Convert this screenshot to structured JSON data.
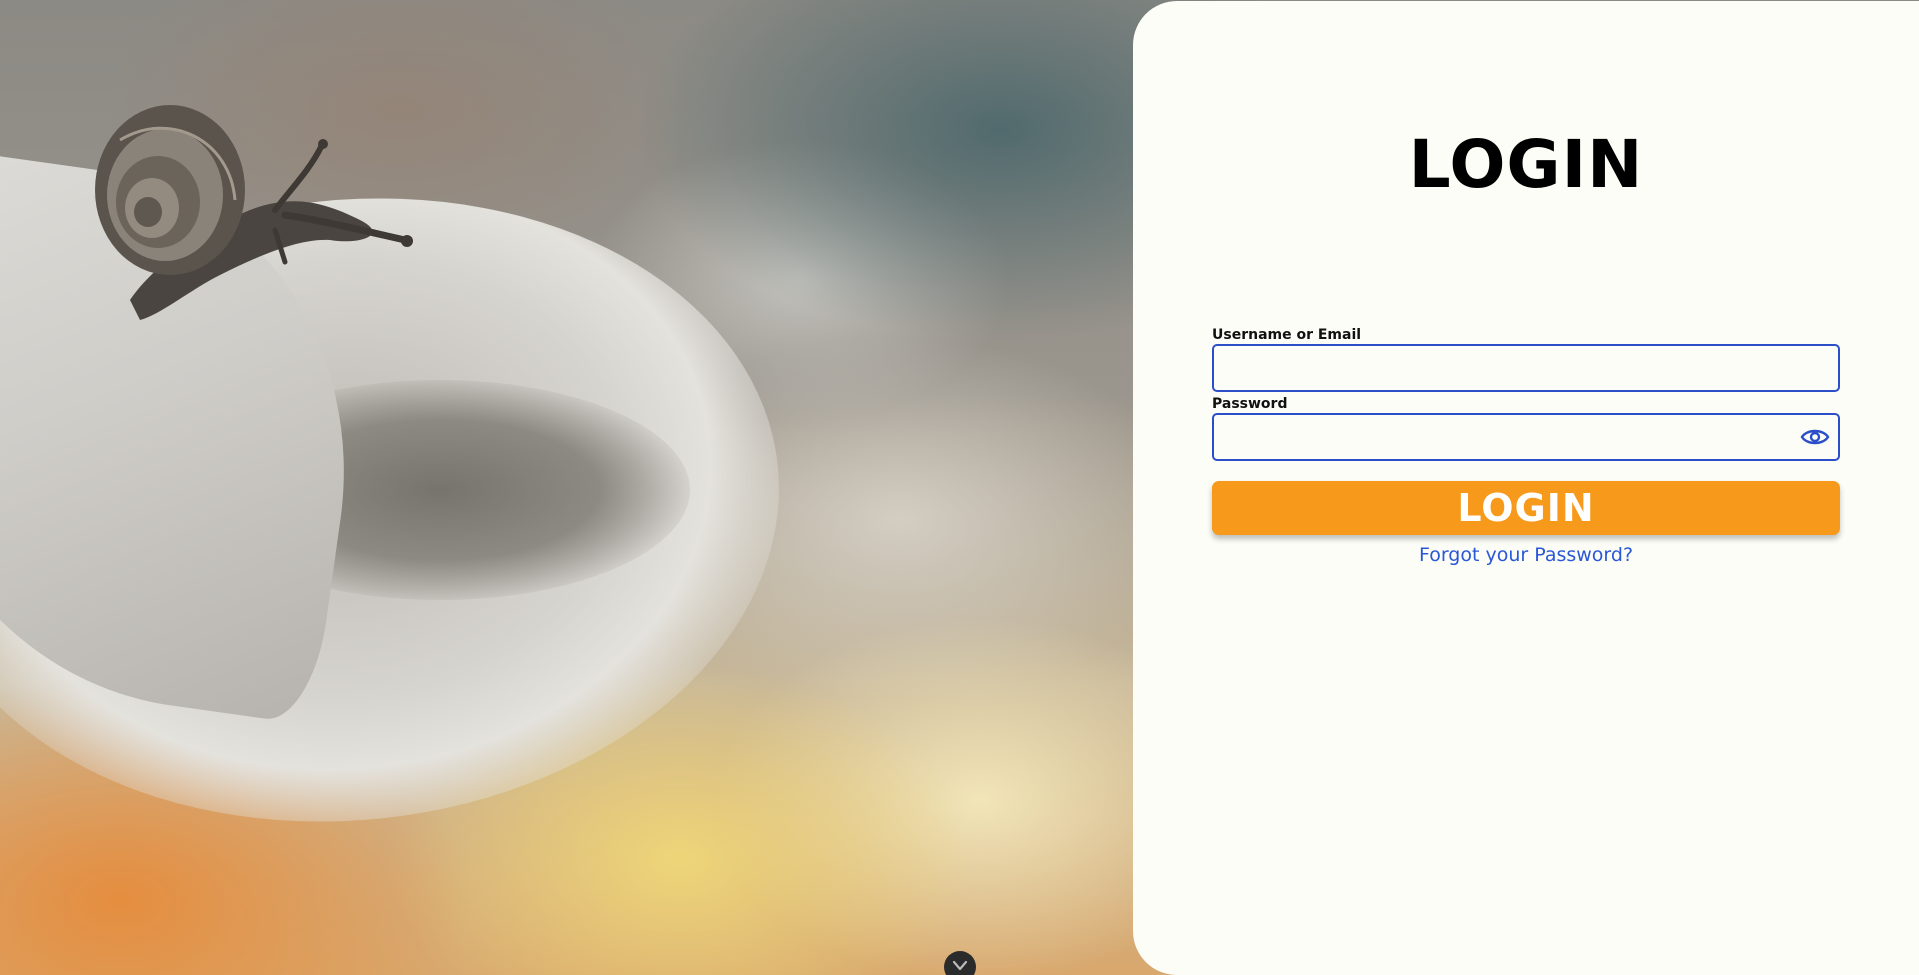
{
  "login_panel": {
    "title": "LOGIN",
    "username_label": "Username or Email",
    "username_value": "",
    "password_label": "Password",
    "password_value": "",
    "show_password_icon": "eye-icon",
    "login_button_label": "LOGIN",
    "forgot_password_link": "Forgot your Password?"
  },
  "background": {
    "image": "snail-on-leaf-photo"
  },
  "scroll_handle": {
    "icon": "chevron-down-icon"
  },
  "colors": {
    "panel_background": "#fdfdf7",
    "input_border": "#2c4ec9",
    "login_button": "#f7991a",
    "link": "#2a57d6"
  }
}
